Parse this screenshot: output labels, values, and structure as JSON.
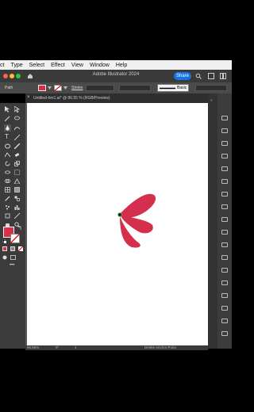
{
  "menubar": {
    "items": [
      "ct",
      "Type",
      "Select",
      "Effect",
      "View",
      "Window",
      "Help"
    ]
  },
  "appbar": {
    "title": "Adobe Illustrator 2024",
    "share_label": "Share"
  },
  "control_bar": {
    "object_type": "Path",
    "stroke_label": "Stroke",
    "brush_label": "Basic"
  },
  "document_tab": {
    "title": "Untitled-hm1.ai* @ 86.55 % (RGB/Preview)"
  },
  "status": {
    "zoom": "86.55%",
    "rotation": "0°",
    "artboard_number": "1",
    "tool_hint": "Delete Anchor Point"
  },
  "colors": {
    "fill": "#d73047",
    "artwork": "#d42f4c",
    "share": "#1473e6"
  }
}
